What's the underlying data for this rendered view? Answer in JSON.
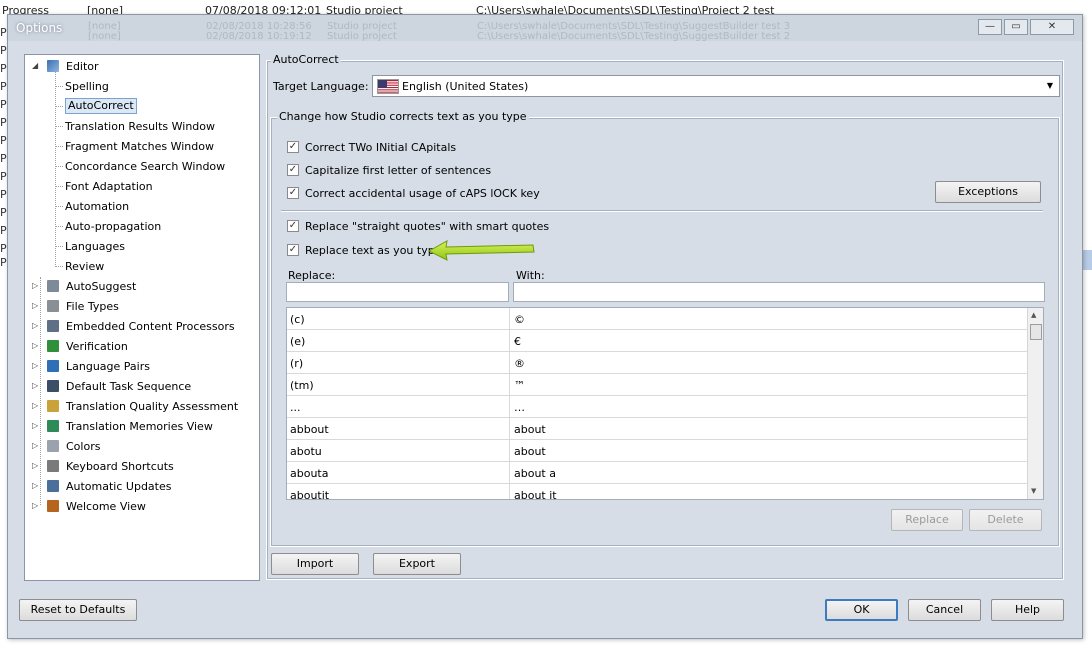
{
  "background_app": {
    "row1": {
      "col1": "Progress",
      "col2": "[none]",
      "col3": "07/08/2018 09:12:01",
      "col4": "Studio project",
      "col5": "C:\\Users\\swhale\\Documents\\SDL\\Testing\\Project 2 test"
    },
    "row2": {
      "col2": "[none]",
      "col3": "02/08/2018 10:28:56",
      "col4": "Studio project",
      "col5": "C:\\Users\\swhale\\Documents\\SDL\\Testing\\SuggestBuilder test 3"
    },
    "row3": {
      "col2": "[none]",
      "col3": "02/08/2018 10:19:12",
      "col4": "Studio project",
      "col5": "C:\\Users\\swhale\\Documents\\SDL\\Testing\\SuggestBuilder test 2"
    },
    "left_letters": [
      "Pr",
      "Pr",
      "Pr",
      "Pr",
      "Pr",
      "Pr",
      "Pr",
      "Pr",
      "Pr",
      "Pr",
      "Pr",
      "Pr",
      "Pr"
    ],
    "left_letter_last": "P"
  },
  "window": {
    "title": "Options",
    "minimize": "—",
    "restore": "▭",
    "close": "✕"
  },
  "tree": {
    "editor": "Editor",
    "editor_children": [
      "Spelling",
      "AutoCorrect",
      "Translation Results Window",
      "Fragment Matches Window",
      "Concordance Search Window",
      "Font Adaptation",
      "Automation",
      "Auto-propagation",
      "Languages",
      "Review"
    ],
    "selected": "AutoCorrect",
    "top_level": [
      "AutoSuggest",
      "File Types",
      "Embedded Content Processors",
      "Verification",
      "Language Pairs",
      "Default Task Sequence",
      "Translation Quality Assessment",
      "Translation Memories View",
      "Colors",
      "Keyboard Shortcuts",
      "Automatic Updates",
      "Welcome View"
    ]
  },
  "panel": {
    "title": "AutoCorrect",
    "target_language_label": "Target Language:",
    "target_language_value": "English (United States)",
    "group_title": "Change how Studio corrects text as you type",
    "checkboxes": [
      {
        "label": "Correct TWo INitial CApitals",
        "checked": "✓"
      },
      {
        "label": "Capitalize first letter of sentences",
        "checked": "✓"
      },
      {
        "label": "Correct accidental usage of cAPS lOCK key",
        "checked": "✓"
      },
      {
        "label": "Replace \"straight quotes\" with smart quotes",
        "checked": "✓"
      },
      {
        "label": "Replace text as you type",
        "checked": "✓"
      }
    ],
    "exceptions_button": "Exceptions",
    "replace_header": "Replace:",
    "with_header": "With:",
    "replace_input": "",
    "with_input": "",
    "rows": [
      {
        "replace": "(c)",
        "with": "©"
      },
      {
        "replace": "(e)",
        "with": "€"
      },
      {
        "replace": "(r)",
        "with": "®"
      },
      {
        "replace": "(tm)",
        "with": "™"
      },
      {
        "replace": "...",
        "with": "…"
      },
      {
        "replace": "abbout",
        "with": "about"
      },
      {
        "replace": "abotu",
        "with": "about"
      },
      {
        "replace": "abouta",
        "with": "about a"
      },
      {
        "replace": "aboutit",
        "with": "about it"
      }
    ],
    "replace_button": "Replace",
    "delete_button": "Delete",
    "import_button": "Import",
    "export_button": "Export"
  },
  "footer": {
    "reset_button": "Reset to Defaults",
    "ok_button": "OK",
    "cancel_button": "Cancel",
    "help_button": "Help"
  },
  "colors": {
    "annotation_arrow": "#b8e61b",
    "selection_border": "#7da2ce",
    "default_button_border": "#3d7bbf"
  }
}
